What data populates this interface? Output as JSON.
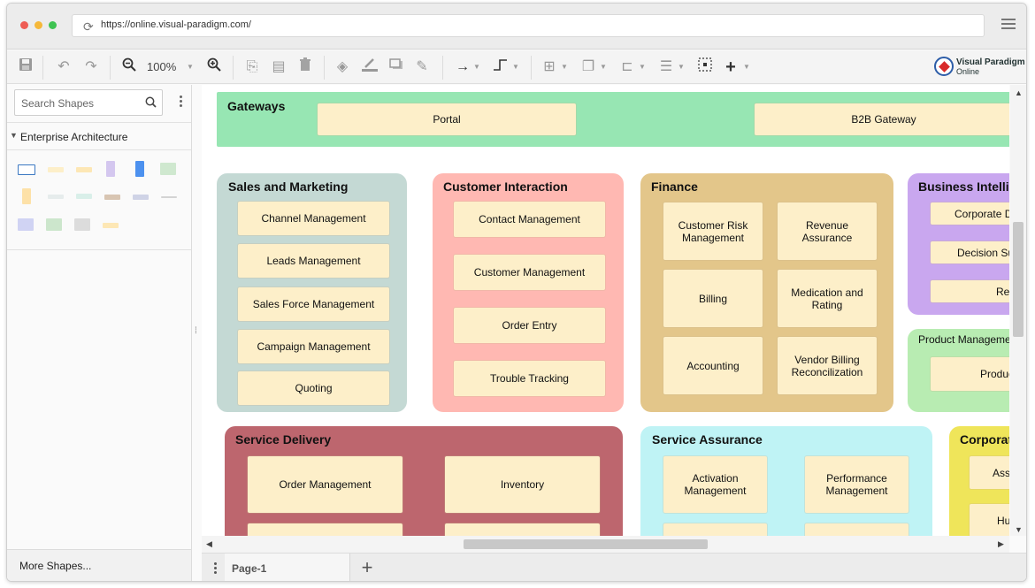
{
  "browser": {
    "url": "https://online.visual-paradigm.com/"
  },
  "toolbar": {
    "zoom": "100%"
  },
  "logo": {
    "line1": "Visual Paradigm",
    "line2": "Online"
  },
  "sidebar": {
    "search_placeholder": "Search Shapes",
    "category": "Enterprise Architecture",
    "more_shapes": "More Shapes..."
  },
  "colors": {
    "gateways": "#97e6b3",
    "sales": "#c4d9d4",
    "customer": "#ffb8b2",
    "finance": "#e3c68a",
    "bi": "#c9a7ef",
    "product": "#b8ecb2",
    "delivery": "#bd666e",
    "assurance": "#bff3f5",
    "corporate": "#efe55a",
    "box": "#fdefc9"
  },
  "diagram": {
    "gateways": {
      "title": "Gateways",
      "items": [
        "Portal",
        "B2B Gateway"
      ]
    },
    "sales": {
      "title": "Sales and Marketing",
      "items": [
        "Channel Management",
        "Leads Management",
        "Sales Force Management",
        "Campaign Management",
        "Quoting"
      ]
    },
    "customer": {
      "title": "Customer Interaction",
      "items": [
        "Contact Management",
        "Customer Management",
        "Order Entry",
        "Trouble Tracking"
      ]
    },
    "finance": {
      "title": "Finance",
      "items": [
        "Customer Risk Management",
        "Revenue Assurance",
        "Billing",
        "Medication and Rating",
        "Accounting",
        "Vendor Billing Reconcilization"
      ]
    },
    "bi": {
      "title": "Business Intellig",
      "items": [
        "Corporate Da",
        "Decision Sup",
        "Rep"
      ]
    },
    "product": {
      "title": "Product Managemen",
      "items": [
        "Product"
      ]
    },
    "delivery": {
      "title": "Service Delivery",
      "items": [
        "Order Management",
        "Inventory"
      ]
    },
    "assurance": {
      "title": "Service Assurance",
      "items": [
        "Activation Management",
        "Performance Management"
      ]
    },
    "corporate": {
      "title": "Corporate",
      "items": [
        "Asse",
        "Hum"
      ]
    }
  },
  "pages": {
    "tab": "Page-1"
  }
}
